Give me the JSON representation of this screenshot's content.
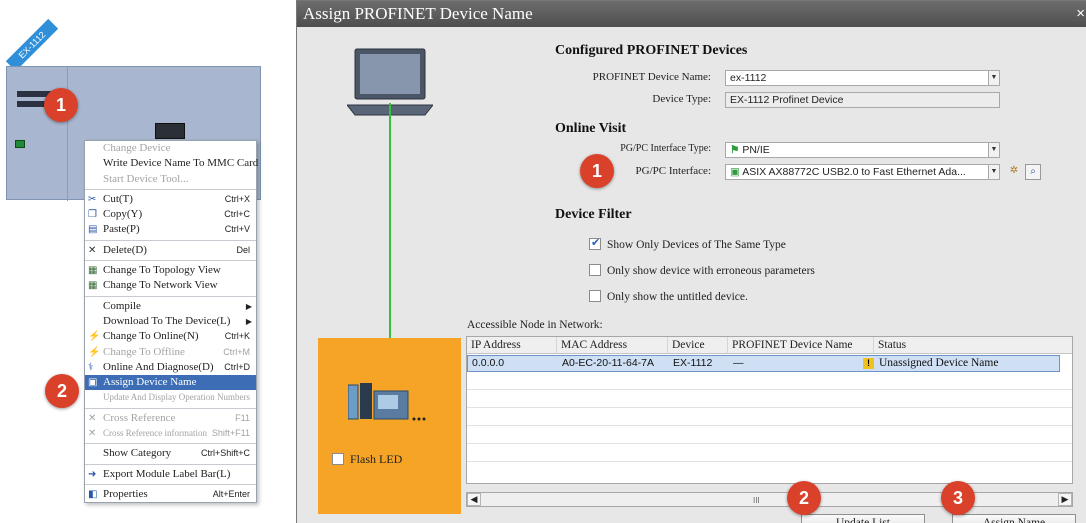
{
  "network_view": {
    "device_tag": "EX-1112",
    "badge_1": "1",
    "badge_2": "2"
  },
  "context_menu": {
    "items": [
      {
        "label": "Change Device",
        "shortcut": "",
        "state": "disabled",
        "icon": ""
      },
      {
        "label": "Write Device Name To MMC Card",
        "shortcut": "",
        "state": "normal",
        "icon": ""
      },
      {
        "label": "Start Device Tool...",
        "shortcut": "",
        "state": "disabled",
        "icon": ""
      },
      {
        "label": "Cut(T)",
        "shortcut": "Ctrl+X",
        "state": "normal",
        "icon": "cut-icon"
      },
      {
        "label": "Copy(Y)",
        "shortcut": "Ctrl+C",
        "state": "normal",
        "icon": "copy-icon"
      },
      {
        "label": "Paste(P)",
        "shortcut": "Ctrl+V",
        "state": "normal",
        "icon": "paste-icon"
      },
      {
        "label": "Delete(D)",
        "shortcut": "Del",
        "state": "normal",
        "icon": "delete-icon"
      },
      {
        "label": "Change To Topology View",
        "shortcut": "",
        "state": "normal",
        "icon": "topology-icon"
      },
      {
        "label": "Change To Network View",
        "shortcut": "",
        "state": "normal",
        "icon": "network-icon"
      },
      {
        "label": "Compile",
        "shortcut": "",
        "state": "normal",
        "icon": "",
        "submenu": true
      },
      {
        "label": "Download To The Device(L)",
        "shortcut": "",
        "state": "normal",
        "icon": "",
        "submenu": true
      },
      {
        "label": "Change To Online(N)",
        "shortcut": "Ctrl+K",
        "state": "normal",
        "icon": "online-icon"
      },
      {
        "label": "Change To Offline",
        "shortcut": "Ctrl+M",
        "state": "disabled",
        "icon": "offline-icon"
      },
      {
        "label": "Online And Diagnose(D)",
        "shortcut": "Ctrl+D",
        "state": "normal",
        "icon": "diagnose-icon"
      },
      {
        "label": "Assign Device Name",
        "shortcut": "",
        "state": "selected",
        "icon": "assign-name-icon"
      },
      {
        "label": "Update And Display Operation Numbers",
        "shortcut": "",
        "state": "disabled",
        "icon": ""
      },
      {
        "label": "Cross Reference",
        "shortcut": "F11",
        "state": "disabled",
        "icon": "cross-ref-icon"
      },
      {
        "label": "Cross Reference information",
        "shortcut": "Shift+F11",
        "state": "disabled",
        "icon": "cross-ref-info-icon"
      },
      {
        "label": "Show Category",
        "shortcut": "Ctrl+Shift+C",
        "state": "normal",
        "icon": ""
      },
      {
        "label": "Export Module Label Bar(L)",
        "shortcut": "",
        "state": "normal",
        "icon": "export-icon"
      },
      {
        "label": "Properties",
        "shortcut": "Alt+Enter",
        "state": "normal",
        "icon": "properties-icon"
      }
    ]
  },
  "dialog": {
    "title": "Assign PROFINET Device Name",
    "close": "×",
    "configured": {
      "heading": "Configured PROFINET Devices",
      "name_label": "PROFINET Device Name:",
      "name_value": "ex-1112",
      "type_label": "Device Type:",
      "type_value": "EX-1112 Profinet Device"
    },
    "online_visit": {
      "heading": "Online Visit",
      "iface_type_label": "PG/PC Interface Type:",
      "iface_type_value": "PN/IE",
      "iface_label": "PG/PC Interface:",
      "iface_value": "ASIX AX88772C USB2.0 to Fast Ethernet Ada...",
      "badge": "1"
    },
    "device_filter": {
      "heading": "Device Filter",
      "options": [
        {
          "label": "Show Only Devices of The Same Type",
          "checked": true
        },
        {
          "label": "Only show device with erroneous parameters",
          "checked": false
        },
        {
          "label": "Only show the untitled device.",
          "checked": false
        }
      ]
    },
    "flash_led": "Flash LED",
    "grid": {
      "caption": "Accessible Node in Network:",
      "columns": [
        "IP Address",
        "MAC Address",
        "Device",
        "PROFINET Device Name",
        "Status"
      ],
      "rows": [
        {
          "ip": "0.0.0.0",
          "mac": "A0-EC-20-11-64-7A",
          "device": "EX-1112",
          "name": "—",
          "status": "Unassigned Device Name"
        }
      ]
    },
    "scroll_thumb": "III",
    "buttons": {
      "update_list": "Update List",
      "assign_name": "Assign Name",
      "badge_update": "2",
      "badge_assign": "3"
    }
  }
}
